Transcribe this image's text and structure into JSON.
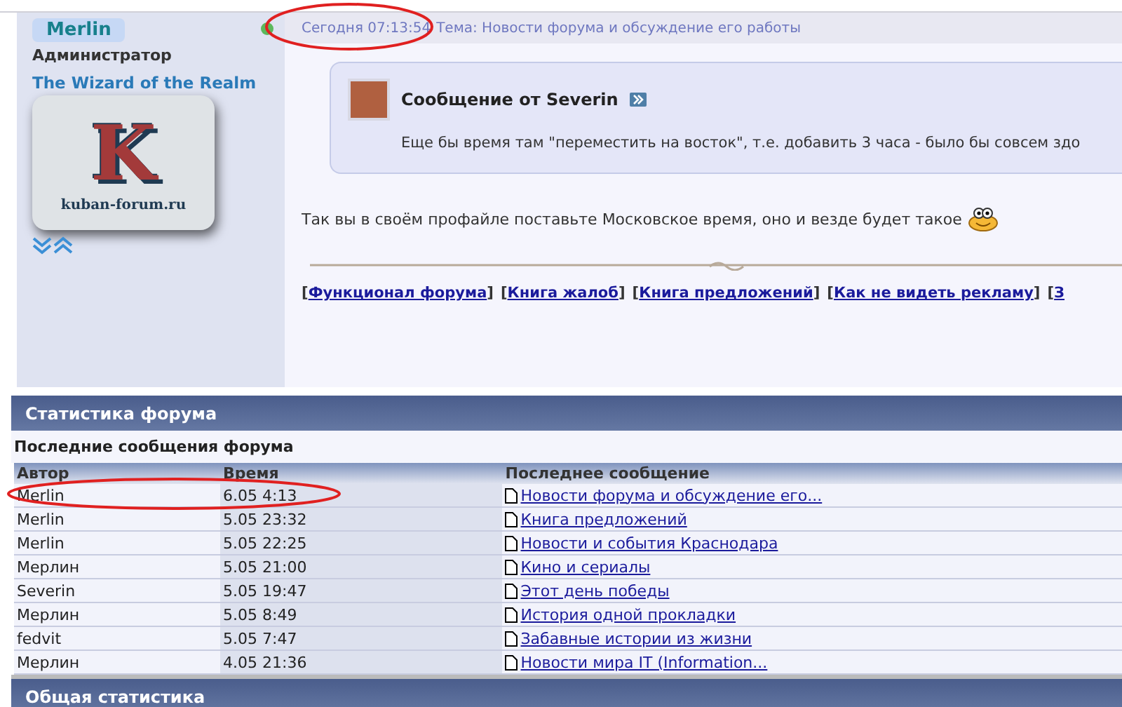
{
  "post": {
    "author": {
      "name": "Merlin",
      "online": true,
      "rank": "Администратор",
      "title": "The Wizard of the Realm",
      "logo": {
        "letter": "K",
        "site": "kuban-forum.ru"
      }
    },
    "header": {
      "date": "Сегодня 07:13:54",
      "topic": "Тема: Новости форума и обсуждение его работы"
    },
    "quote": {
      "title": "Сообщение от Severin",
      "text": "Еще бы время там \"переместить на восток\", т.е. добавить 3 часа - было бы совсем здо"
    },
    "text": "Так вы в своём профайле поставьте Московское время, оно и везде будет такое",
    "links": [
      {
        "open": "[",
        "text": "Функционал форума",
        "close": "]"
      },
      {
        "open": "[",
        "text": "Книга жалоб",
        "close": "]"
      },
      {
        "open": "[",
        "text": "Книга предложений",
        "close": "]"
      },
      {
        "open": "[",
        "text": "Как не видеть рекламу",
        "close": "]"
      },
      {
        "open": "[",
        "text": "З"
      }
    ]
  },
  "stats": {
    "title": "Статистика форума",
    "subtitle": "Последние сообщения форума",
    "columns": [
      "Автор",
      "Время",
      "Последнее сообщение"
    ],
    "rows": [
      {
        "author": "Merlin",
        "time": "6.05 4:13",
        "topic": "Новости форума и обсуждение его..."
      },
      {
        "author": "Merlin",
        "time": "5.05 23:32",
        "topic": "Книга предложений"
      },
      {
        "author": "Merlin",
        "time": "5.05 22:25",
        "topic": "Новости и события Краснодара"
      },
      {
        "author": "Мерлин",
        "time": "5.05 21:00",
        "topic": "Кино и сериалы"
      },
      {
        "author": "Severin",
        "time": "5.05 19:47",
        "topic": "Этот день победы"
      },
      {
        "author": "Мерлин",
        "time": "5.05 8:49",
        "topic": "История одной прокладки"
      },
      {
        "author": "fedvit",
        "time": "5.05 7:47",
        "topic": "Забавные истории из жизни"
      },
      {
        "author": "Мерлин",
        "time": "4.05 21:36",
        "topic": "Новости мира IT (Information..."
      }
    ]
  },
  "general": {
    "title": "Общая статистика"
  }
}
